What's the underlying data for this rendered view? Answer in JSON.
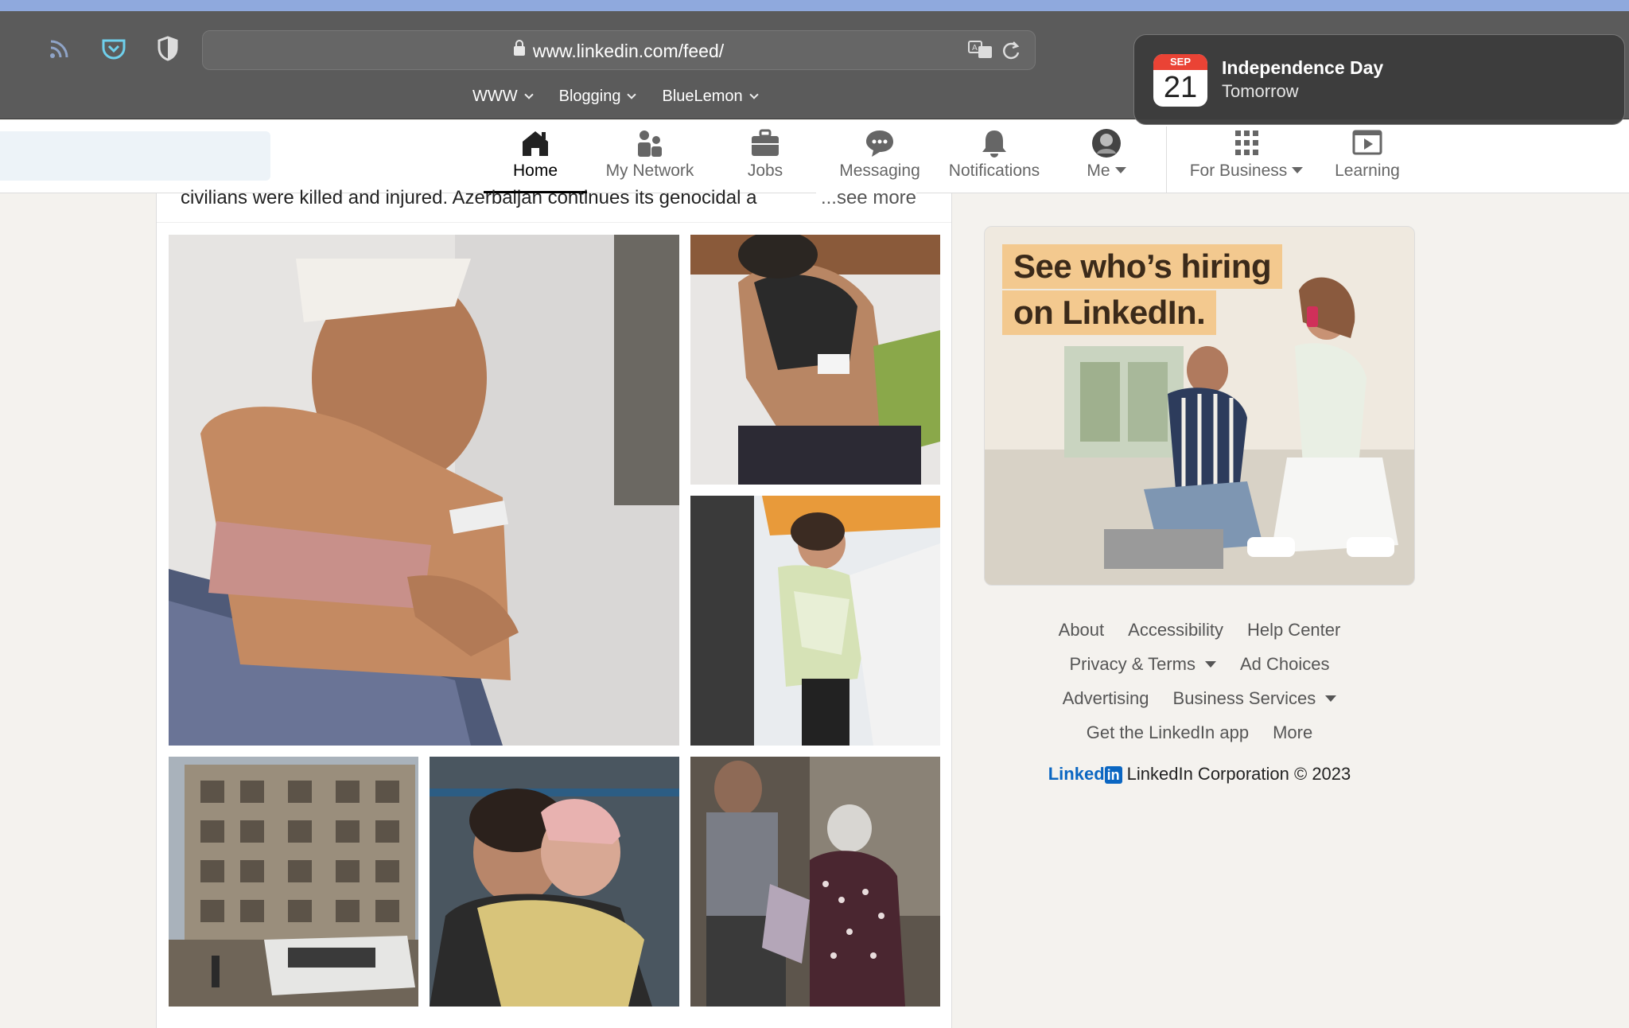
{
  "browser": {
    "url": "www.linkedin.com/feed/",
    "bookmarks": [
      {
        "label": "WWW"
      },
      {
        "label": "Blogging"
      },
      {
        "label": "BlueLemon"
      }
    ]
  },
  "notification": {
    "calendar_month": "SEP",
    "calendar_day": "21",
    "title": "Independence Day",
    "subtitle": "Tomorrow"
  },
  "nav": {
    "items": [
      {
        "label": "Home",
        "icon": "home-icon",
        "active": true
      },
      {
        "label": "My Network",
        "icon": "network-icon"
      },
      {
        "label": "Jobs",
        "icon": "briefcase-icon"
      },
      {
        "label": "Messaging",
        "icon": "chat-icon"
      },
      {
        "label": "Notifications",
        "icon": "bell-icon"
      },
      {
        "label": "Me",
        "icon": "avatar"
      },
      {
        "label": "For Business",
        "icon": "grid-icon"
      },
      {
        "label": "Learning",
        "icon": "play-icon"
      }
    ]
  },
  "post": {
    "text": "civilians were killed and injured. Azerbaijan continues its genocidal a",
    "see_more": "...see more"
  },
  "ad": {
    "line1": "See who’s hiring",
    "line2": "on LinkedIn."
  },
  "footer": {
    "links": [
      "About",
      "Accessibility",
      "Help Center",
      "Privacy & Terms",
      "Ad Choices",
      "Advertising",
      "Business Services",
      "Get the LinkedIn app",
      "More"
    ],
    "brand": "Linked",
    "brand_in": "in",
    "copyright": "LinkedIn Corporation © 2023"
  },
  "colors": {
    "linkedin_blue": "#0a66c2",
    "toolbar": "#5b5b5b",
    "page_bg": "#f4f2ee"
  }
}
